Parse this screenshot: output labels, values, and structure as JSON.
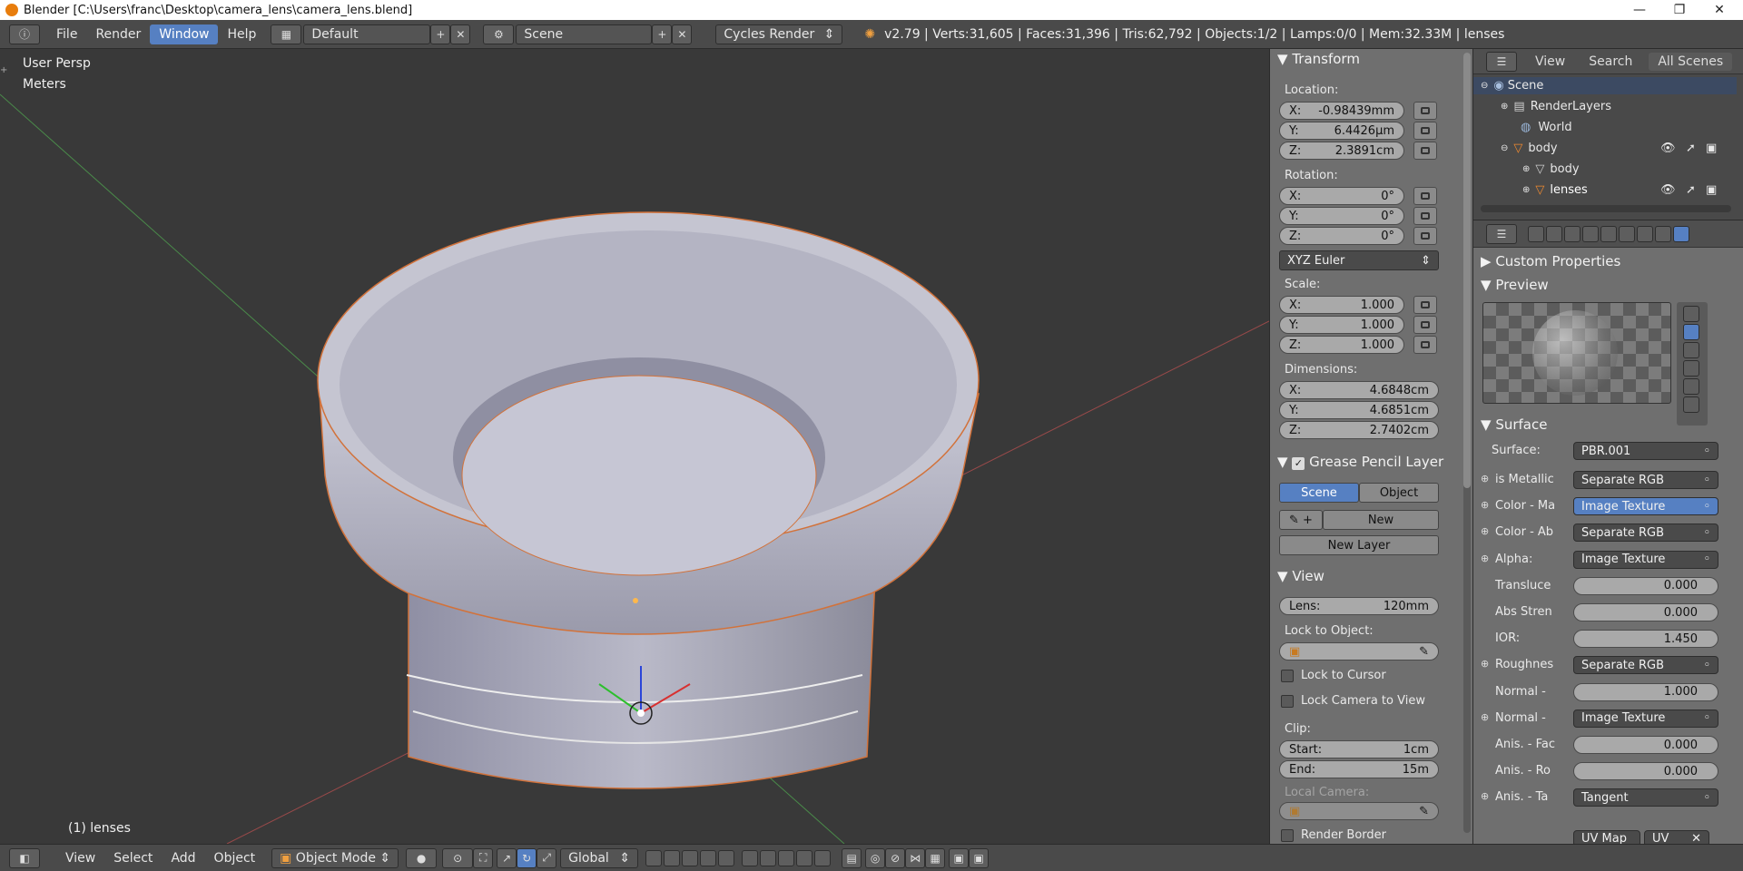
{
  "titlebar": {
    "title": "Blender [C:\\Users\\franc\\Desktop\\camera_lens\\camera_lens.blend]",
    "minimize": "—",
    "maximize": "❐",
    "close": "✕"
  },
  "topbar": {
    "menus": [
      "File",
      "Render",
      "Window",
      "Help"
    ],
    "active_menu": "Window",
    "layout": "Default",
    "scene": "Scene",
    "engine": "Cycles Render",
    "stats": "v2.79 | Verts:31,605 | Faces:31,396 | Tris:62,792 | Objects:1/2 | Lamps:0/0 | Mem:32.33M | lenses"
  },
  "viewport": {
    "view_name": "User Persp",
    "units": "Meters",
    "object_label": "(1) lenses"
  },
  "npanel": {
    "transform_title": "Transform",
    "location_label": "Location:",
    "location": [
      {
        "k": "X:",
        "v": "-0.98439mm"
      },
      {
        "k": "Y:",
        "v": "6.4426µm"
      },
      {
        "k": "Z:",
        "v": "2.3891cm"
      }
    ],
    "rotation_label": "Rotation:",
    "rotation": [
      {
        "k": "X:",
        "v": "0°"
      },
      {
        "k": "Y:",
        "v": "0°"
      },
      {
        "k": "Z:",
        "v": "0°"
      }
    ],
    "rotation_mode": "XYZ Euler",
    "scale_label": "Scale:",
    "scale": [
      {
        "k": "X:",
        "v": "1.000"
      },
      {
        "k": "Y:",
        "v": "1.000"
      },
      {
        "k": "Z:",
        "v": "1.000"
      }
    ],
    "dimensions_label": "Dimensions:",
    "dimensions": [
      {
        "k": "X:",
        "v": "4.6848cm"
      },
      {
        "k": "Y:",
        "v": "4.6851cm"
      },
      {
        "k": "Z:",
        "v": "2.7402cm"
      }
    ],
    "grease_title": "Grease Pencil Layer",
    "grease_scene": "Scene",
    "grease_object": "Object",
    "grease_new": "New",
    "grease_new_layer": "New Layer",
    "view_title": "View",
    "lens_label": "Lens:",
    "lens_value": "120mm",
    "lock_to_object": "Lock to Object:",
    "lock_to_cursor": "Lock to Cursor",
    "lock_camera_to_view": "Lock Camera to View",
    "clip_label": "Clip:",
    "clip_start_label": "Start:",
    "clip_start": "1cm",
    "clip_end_label": "End:",
    "clip_end": "15m",
    "local_camera": "Local Camera:",
    "render_border": "Render Border"
  },
  "outliner": {
    "view": "View",
    "search": "Search",
    "filter": "All Scenes",
    "items": [
      {
        "label": "Scene",
        "indent": 0
      },
      {
        "label": "RenderLayers",
        "indent": 1
      },
      {
        "label": "World",
        "indent": 1
      },
      {
        "label": "body",
        "indent": 1
      },
      {
        "label": "body",
        "indent": 2
      },
      {
        "label": "lenses",
        "indent": 2
      }
    ]
  },
  "props": {
    "custom_properties": "Custom Properties",
    "preview": "Preview",
    "surface_title": "Surface",
    "surface_label": "Surface:",
    "surface_value": "PBR.001",
    "rows": [
      {
        "label": "is Metallic",
        "value": "Separate RGB",
        "type": "pill"
      },
      {
        "label": "Color - Ma",
        "value": "Image Texture",
        "type": "pill-blue"
      },
      {
        "label": "Color - Ab",
        "value": "Separate RGB",
        "type": "pill"
      },
      {
        "label": "Alpha:",
        "value": "Image Texture",
        "type": "pill"
      },
      {
        "label": "Transluce",
        "value": "0.000",
        "type": "slider"
      },
      {
        "label": "Abs Stren",
        "value": "0.000",
        "type": "slider"
      },
      {
        "label": "IOR:",
        "value": "1.450",
        "type": "slider"
      },
      {
        "label": "Roughnes",
        "value": "Separate RGB",
        "type": "pill"
      },
      {
        "label": "Normal -",
        "value": "1.000",
        "type": "slider"
      },
      {
        "label": "Normal -",
        "value": "Image Texture",
        "type": "pill"
      },
      {
        "label": "Anis. - Fac",
        "value": "0.000",
        "type": "slider"
      },
      {
        "label": "Anis. - Ro",
        "value": "0.000",
        "type": "slider"
      },
      {
        "label": "Anis. - Ta",
        "value": "Tangent",
        "type": "pill"
      }
    ],
    "uv_map": "UV Map",
    "uv": "UV"
  },
  "bottombar": {
    "menus": [
      "View",
      "Select",
      "Add",
      "Object"
    ],
    "mode": "Object Mode",
    "orientation": "Global"
  }
}
